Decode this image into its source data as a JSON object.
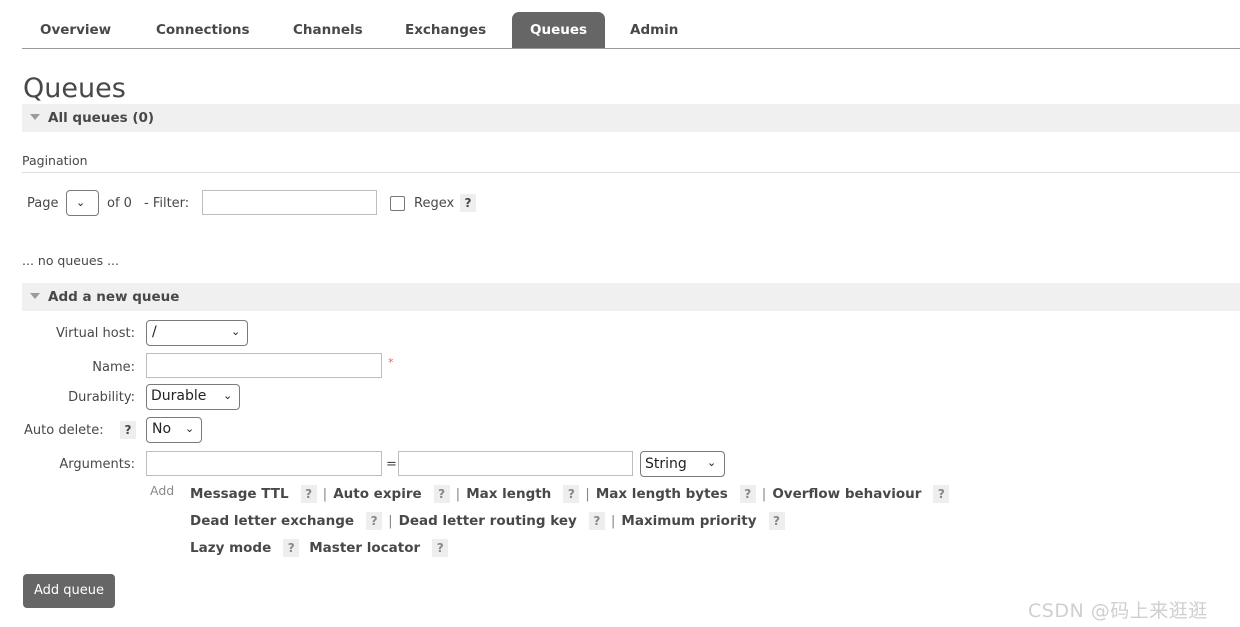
{
  "nav": {
    "tabs": [
      {
        "label": "Overview",
        "active": false
      },
      {
        "label": "Connections",
        "active": false
      },
      {
        "label": "Channels",
        "active": false
      },
      {
        "label": "Exchanges",
        "active": false
      },
      {
        "label": "Queues",
        "active": true
      },
      {
        "label": "Admin",
        "active": false
      }
    ]
  },
  "page_title": "Queues",
  "all_queues": {
    "label": "All queues (0)"
  },
  "pagination": {
    "label": "Pagination",
    "page_label": "Page",
    "of_text": "of 0",
    "filter_label": "- Filter:",
    "filter_value": "",
    "regex_label": "Regex",
    "regex_checked": false,
    "help": "?"
  },
  "no_queues_text": "... no queues ...",
  "add_queue_section": {
    "label": "Add a new queue",
    "virtual_host": {
      "label": "Virtual host:",
      "value": "/"
    },
    "name": {
      "label": "Name:",
      "value": "",
      "required_mark": "*"
    },
    "durability": {
      "label": "Durability:",
      "value": "Durable"
    },
    "auto_delete": {
      "label": "Auto delete:",
      "value": "No",
      "help": "?"
    },
    "arguments": {
      "label": "Arguments:",
      "key": "",
      "equals": "=",
      "value": "",
      "type": "String"
    },
    "add_label": "Add",
    "options_row1": [
      "Message TTL",
      "Auto expire",
      "Max length",
      "Max length bytes",
      "Overflow behaviour"
    ],
    "options_row2": [
      "Dead letter exchange",
      "Dead letter routing key",
      "Maximum priority"
    ],
    "options_row3": [
      "Lazy mode",
      "Master locator"
    ],
    "help": "?",
    "separator": "|",
    "submit_label": "Add queue"
  },
  "watermark": "CSDN @码上来逛逛",
  "colors": {
    "tab_active_bg": "#666666",
    "section_bg": "#f0f0f0",
    "text": "#484848",
    "button_bg": "#666666"
  }
}
